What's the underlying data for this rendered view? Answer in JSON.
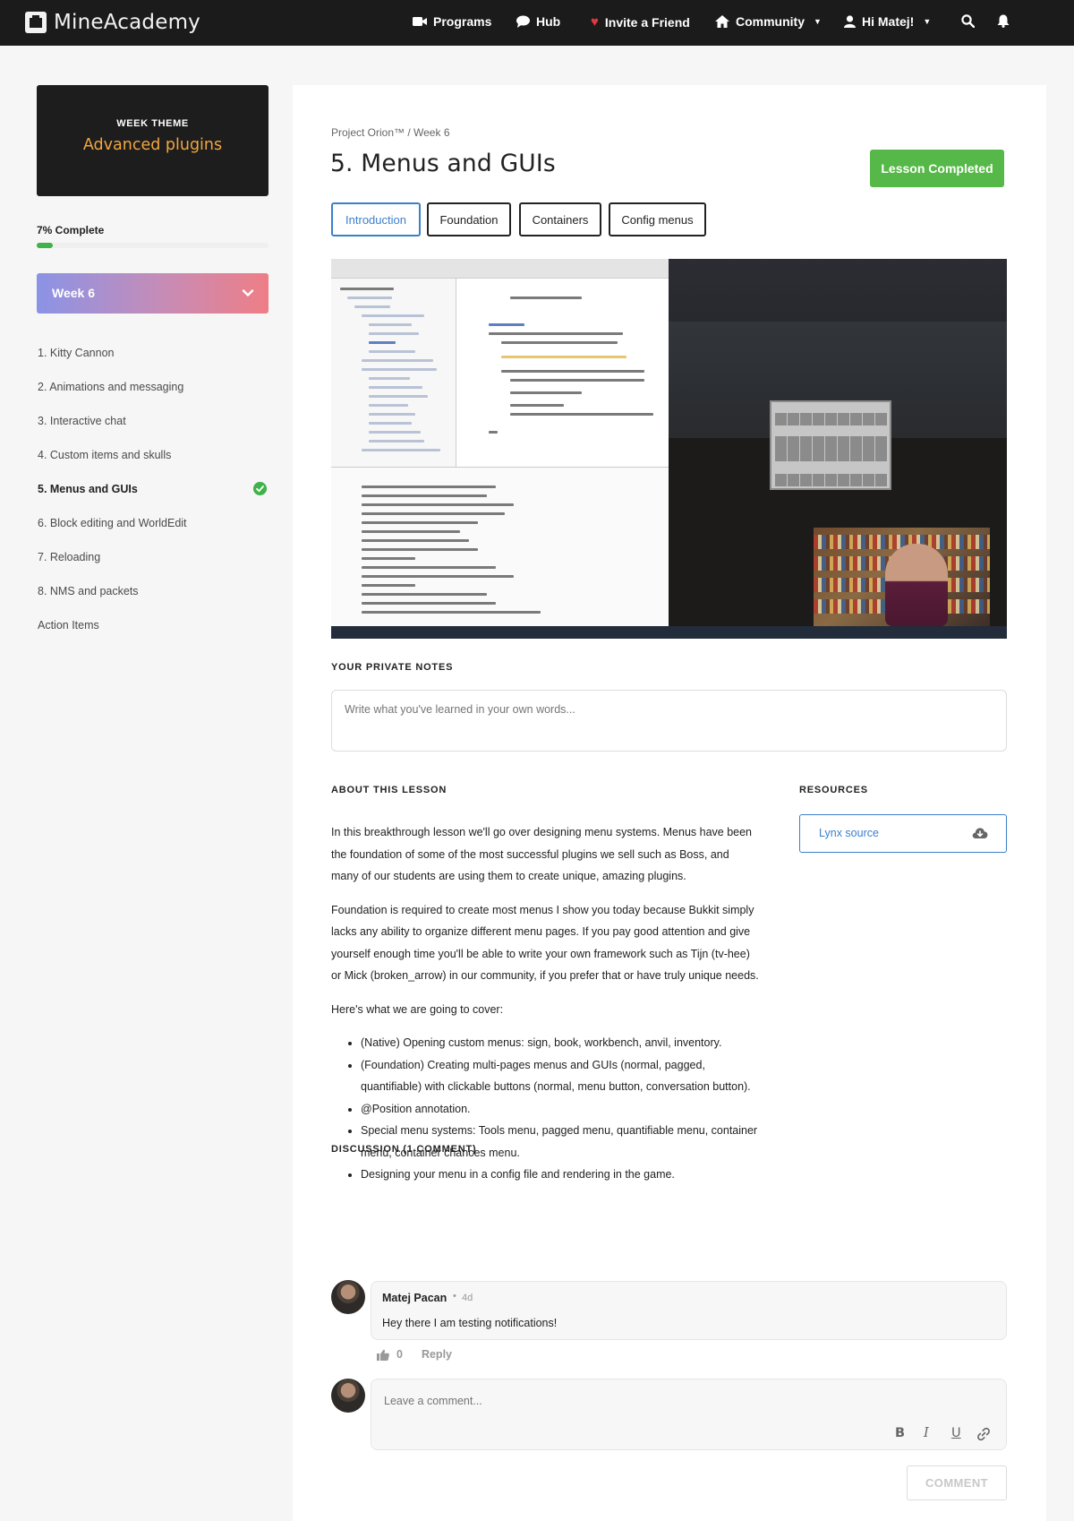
{
  "nav": {
    "brand": "MineAcademy",
    "programs": "Programs",
    "hub": "Hub",
    "invite": "Invite a Friend",
    "community": "Community",
    "user": "Hi Matej!"
  },
  "sidebar": {
    "theme_label": "WEEK THEME",
    "theme_value": "Advanced plugins",
    "progress_label": "7% Complete",
    "progress_value": 0.07,
    "week_label": "Week 6",
    "lessons": [
      {
        "label": "1. Kitty Cannon"
      },
      {
        "label": "2. Animations and messaging"
      },
      {
        "label": "3. Interactive chat"
      },
      {
        "label": "4. Custom items and skulls"
      },
      {
        "label": "5. Menus and GUIs",
        "active": true,
        "completed": true
      },
      {
        "label": "6. Block editing and WorldEdit"
      },
      {
        "label": "7. Reloading"
      },
      {
        "label": "8. NMS and packets"
      },
      {
        "label": "Action Items"
      }
    ]
  },
  "lesson": {
    "breadcrumb": "Project Orion™ / Week 6",
    "title": "5. Menus and GUIs",
    "completed_label": "Lesson Completed",
    "tabs": [
      {
        "label": "Introduction",
        "active": true
      },
      {
        "label": "Foundation"
      },
      {
        "label": "Containers"
      },
      {
        "label": "Config menus"
      }
    ]
  },
  "notes": {
    "heading": "YOUR PRIVATE NOTES",
    "placeholder": "Write what you've learned in your own words..."
  },
  "about": {
    "heading": "ABOUT THIS LESSON",
    "p1": "In this breakthrough lesson we'll go over designing menu systems. Menus have been the foundation of some of the most successful plugins we sell such as Boss, and many of our students are using them to create unique, amazing plugins.",
    "p2": "Foundation is required to create most menus I show you today because Bukkit simply lacks any ability to organize different menu pages. If you pay good attention and give yourself enough time you'll be able to write your own framework such as Tijn (tv-hee) or Mick (broken_arrow) in our community, if you prefer that or have truly unique needs.",
    "p3": "Here's what we are going to cover:",
    "bullets": [
      "(Native) Opening custom menus: sign, book, workbench, anvil, inventory.",
      "(Foundation) Creating multi-pages menus and GUIs (normal, pagged, quantifiable) with clickable buttons (normal, menu button, conversation button).",
      "@Position annotation.",
      "Special menu systems: Tools menu, pagged menu, quantifiable menu, container menu, container chances menu.",
      "Designing your menu in a config file and rendering  in the game."
    ]
  },
  "resources": {
    "heading": "RESOURCES",
    "item": "Lynx source"
  },
  "discussion": {
    "heading": "DISCUSSION (1 COMMENT)",
    "comment": {
      "author": "Matej Pacan",
      "separator": "•",
      "age": "4d",
      "text": "Hey there I am testing notifications!",
      "likes": "0",
      "reply": "Reply"
    },
    "compose_placeholder": "Leave a comment...",
    "format": {
      "bold": "B",
      "italic": "I",
      "underline": "U"
    },
    "submit": "COMMENT"
  },
  "colors": {
    "accent_blue": "#3b7fcb",
    "success_green": "#56b848",
    "theme_orange": "#f2a640",
    "nav_bg": "#1b1b1b"
  }
}
